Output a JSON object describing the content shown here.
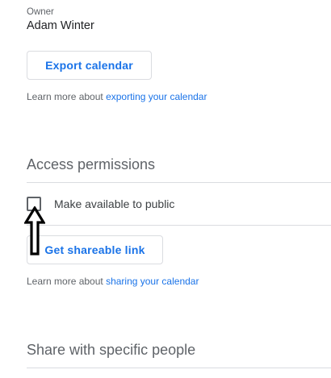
{
  "owner": {
    "label": "Owner",
    "name": "Adam Winter"
  },
  "export": {
    "button_label": "Export calendar",
    "help_prefix": "Learn more about ",
    "help_link": "exporting your calendar"
  },
  "access": {
    "title": "Access permissions",
    "public_checkbox_label": "Make available to public",
    "public_checked": false,
    "share_button_label": "Get shareable link",
    "help_prefix": "Learn more about ",
    "help_link": "sharing your calendar"
  },
  "specific": {
    "title": "Share with specific people"
  },
  "annotation": {
    "icon": "up-arrow-icon"
  },
  "colors": {
    "accent": "#1a73e8",
    "text_secondary": "#5f6368",
    "divider": "#dadce0"
  }
}
